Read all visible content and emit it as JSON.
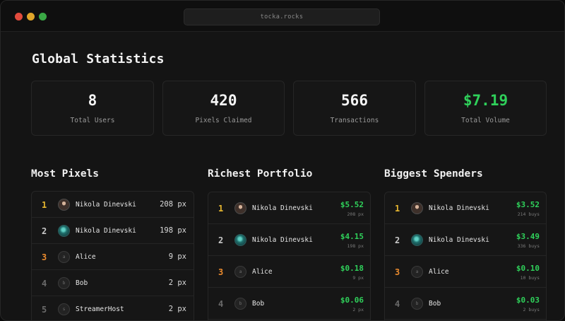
{
  "browser": {
    "url": "tocka.rocks"
  },
  "page": {
    "title": "Global Statistics"
  },
  "stats": [
    {
      "value": "8",
      "label": "Total Users"
    },
    {
      "value": "420",
      "label": "Pixels Claimed"
    },
    {
      "value": "566",
      "label": "Transactions"
    },
    {
      "value": "$7.19",
      "label": "Total Volume",
      "color": "#2fd05a"
    }
  ],
  "most_pixels": {
    "title": "Most Pixels",
    "rows": [
      {
        "rank": "1",
        "avatar": "photo",
        "name": "Nikola Dinevski",
        "value": "208 px"
      },
      {
        "rank": "2",
        "avatar": "photo",
        "name": "Nikola Dinevski",
        "value": "198 px"
      },
      {
        "rank": "3",
        "avatar": "a",
        "name": "Alice",
        "value": "9 px"
      },
      {
        "rank": "4",
        "avatar": "b",
        "name": "Bob",
        "value": "2 px"
      },
      {
        "rank": "5",
        "avatar": "s",
        "name": "StreamerHost",
        "value": "2 px"
      }
    ]
  },
  "richest_portfolio": {
    "title": "Richest Portfolio",
    "rows": [
      {
        "rank": "1",
        "avatar": "photo",
        "name": "Nikola Dinevski",
        "amount": "$5.52",
        "sub": "208 px"
      },
      {
        "rank": "2",
        "avatar": "photo",
        "name": "Nikola Dinevski",
        "amount": "$4.15",
        "sub": "198 px"
      },
      {
        "rank": "3",
        "avatar": "a",
        "name": "Alice",
        "amount": "$0.18",
        "sub": "9 px"
      },
      {
        "rank": "4",
        "avatar": "b",
        "name": "Bob",
        "amount": "$0.06",
        "sub": "2 px"
      }
    ]
  },
  "biggest_spenders": {
    "title": "Biggest Spenders",
    "rows": [
      {
        "rank": "1",
        "avatar": "photo",
        "name": "Nikola Dinevski",
        "amount": "$3.52",
        "sub": "214 buys"
      },
      {
        "rank": "2",
        "avatar": "photo",
        "name": "Nikola Dinevski",
        "amount": "$3.49",
        "sub": "336 buys"
      },
      {
        "rank": "3",
        "avatar": "a",
        "name": "Alice",
        "amount": "$0.10",
        "sub": "10 buys"
      },
      {
        "rank": "4",
        "avatar": "b",
        "name": "Bob",
        "amount": "$0.03",
        "sub": "2 buys"
      }
    ]
  },
  "colors": {
    "accent_green": "#2fd05a",
    "rank_gold": "#e7b730",
    "rank_bronze": "#e98a2e"
  }
}
